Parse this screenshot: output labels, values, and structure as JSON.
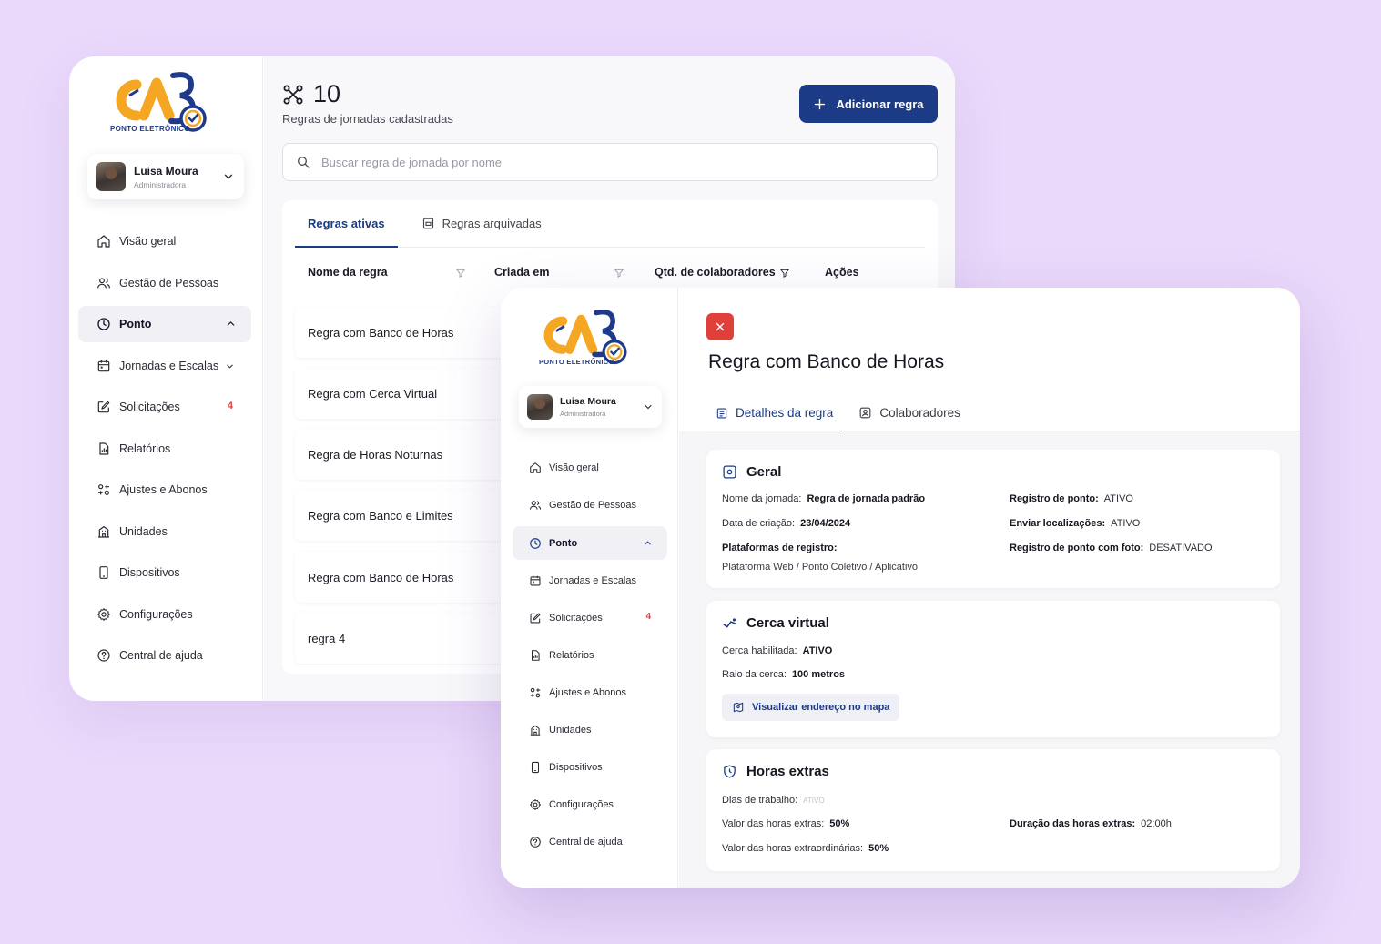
{
  "brand": {
    "logo_text": "CA3",
    "logo_caption": "PONTO ELETRÔNICO"
  },
  "colors": {
    "background": "#ead9fb",
    "primary": "#1b3b86",
    "danger": "#e0403a",
    "logo_orange": "#f5a623",
    "logo_blue": "#1f3a8a"
  },
  "user": {
    "name": "Luisa Moura",
    "role": "Administradora"
  },
  "sidebar": {
    "items": [
      {
        "label": "Visão geral",
        "icon": "home-icon"
      },
      {
        "label": "Gestão de Pessoas",
        "icon": "users-icon"
      },
      {
        "label": "Ponto",
        "icon": "clock-icon",
        "active": true
      },
      {
        "label": "Jornadas e Escalas",
        "icon": "calendar-icon"
      },
      {
        "label": "Solicitações",
        "icon": "edit-icon",
        "badge": "4"
      },
      {
        "label": "Relatórios",
        "icon": "report-icon"
      },
      {
        "label": "Ajustes e Abonos",
        "icon": "adjust-icon"
      },
      {
        "label": "Unidades",
        "icon": "building-icon"
      },
      {
        "label": "Dispositivos",
        "icon": "device-icon"
      },
      {
        "label": "Configurações",
        "icon": "gear-icon"
      },
      {
        "label": "Central de ajuda",
        "icon": "help-icon"
      }
    ]
  },
  "list_view": {
    "count": "10",
    "subtitle": "Regras de jornadas cadastradas",
    "add_button": "Adicionar regra",
    "search_placeholder": "Buscar regra de jornada por nome",
    "tabs": [
      "Regras ativas",
      "Regras arquivadas"
    ],
    "columns": [
      "Nome da regra",
      "Criada em",
      "Qtd. de colaboradores",
      "Ações"
    ],
    "rows": [
      "Regra com Banco de Horas",
      "Regra com Cerca Virtual",
      "Regra de Horas Noturnas",
      "Regra com Banco e Limites",
      "Regra com Banco de Horas",
      "regra 4"
    ]
  },
  "detail_view": {
    "title": "Regra com Banco de Horas",
    "tabs": [
      "Detalhes da regra",
      "Colaboradores"
    ],
    "geral": {
      "title": "Geral",
      "nome_label": "Nome da jornada:",
      "nome_value": "Regra de jornada padrão",
      "data_label": "Data de criação:",
      "data_value": "23/04/2024",
      "plataformas_label": "Plataformas de registro:",
      "plataformas_value": "Plataforma Web / Ponto Coletivo / Aplicativo",
      "registro_label": "Registro de ponto:",
      "registro_value": "ATIVO",
      "localizacoes_label": "Enviar localizações:",
      "localizacoes_value": "ATIVO",
      "foto_label": "Registro de ponto com foto:",
      "foto_value": "DESATIVADO"
    },
    "cerca": {
      "title": "Cerca virtual",
      "habilitada_label": "Cerca habilitada:",
      "habilitada_value": "ATIVO",
      "raio_label": "Raio da cerca:",
      "raio_value": "100 metros",
      "map_button": "Visualizar endereço no mapa"
    },
    "horas": {
      "title": "Horas extras",
      "dias_label": "Dias de trabalho:",
      "dias_value": "ATIVO",
      "valor_label": "Valor das horas extras:",
      "valor_value": "50%",
      "valor_extra_label": "Valor das horas extraordinárias:",
      "valor_extra_value": "50%",
      "duracao_label": "Duração das horas extras:",
      "duracao_value": "02:00h"
    }
  }
}
